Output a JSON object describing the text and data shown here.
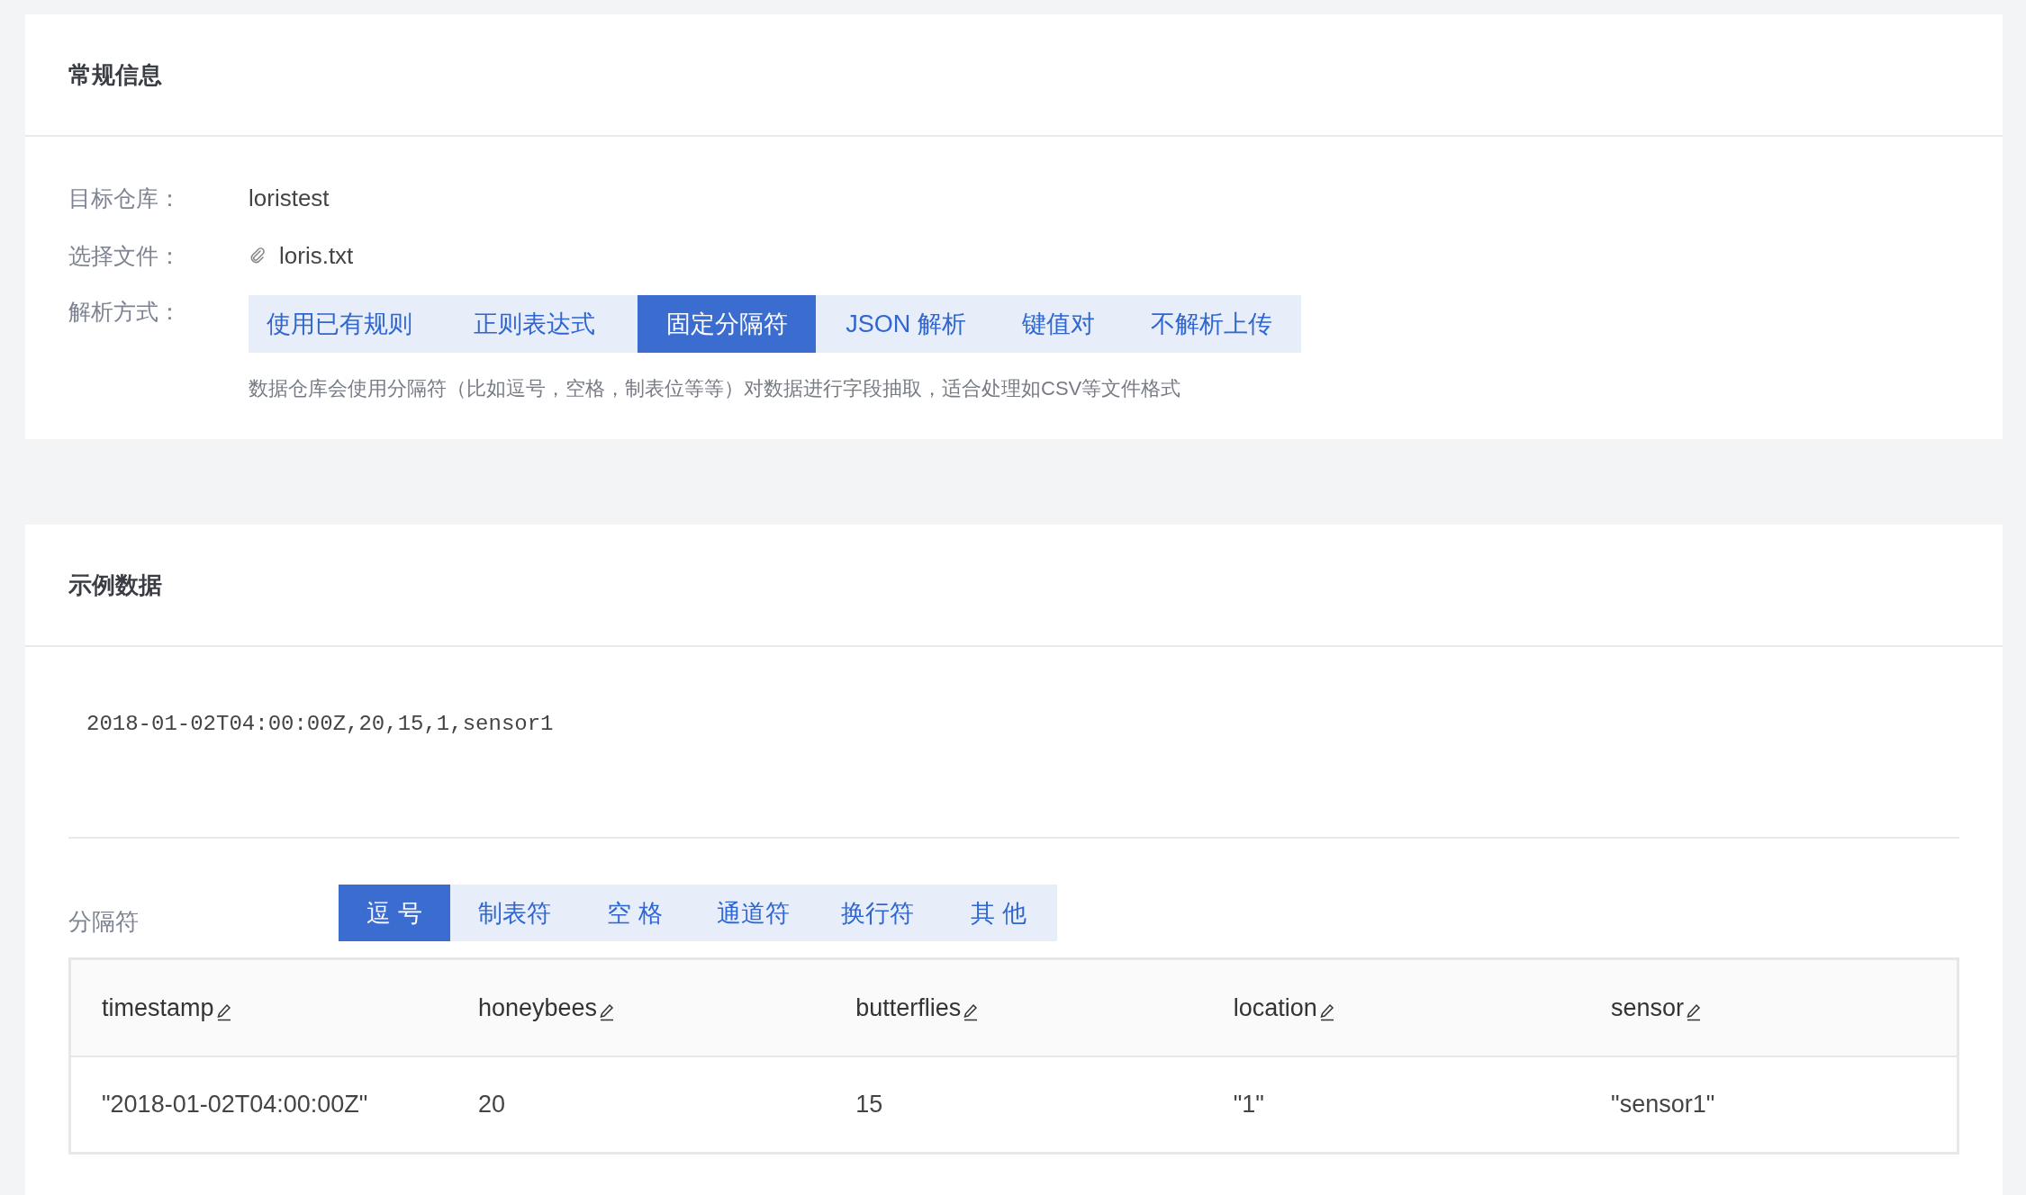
{
  "general": {
    "title": "常规信息",
    "target_label": "目标仓库：",
    "target_value": "loristest",
    "file_label": "选择文件：",
    "file_name": "loris.txt",
    "parse_label": "解析方式：",
    "parse_tabs": [
      {
        "label": "使用已有规则",
        "selected": false
      },
      {
        "label": "正则表达式",
        "selected": false
      },
      {
        "label": "固定分隔符",
        "selected": true
      },
      {
        "label": "JSON 解析",
        "selected": false
      },
      {
        "label": "键值对",
        "selected": false
      },
      {
        "label": "不解析上传",
        "selected": false
      }
    ],
    "hint": "数据仓库会使用分隔符（比如逗号，空格，制表位等等）对数据进行字段抽取，适合处理如CSV等文件格式"
  },
  "sample": {
    "title": "示例数据",
    "text": "2018-01-02T04:00:00Z,20,15,1,sensor1",
    "separator_label": "分隔符",
    "separator_tabs": [
      {
        "label": "逗 号",
        "selected": true
      },
      {
        "label": "制表符",
        "selected": false
      },
      {
        "label": "空 格",
        "selected": false
      },
      {
        "label": "通道符",
        "selected": false
      },
      {
        "label": "换行符",
        "selected": false
      },
      {
        "label": "其 他",
        "selected": false
      }
    ],
    "table": {
      "columns": [
        "timestamp",
        "honeybees",
        "butterflies",
        "location",
        "sensor"
      ],
      "rows": [
        [
          "\"2018-01-02T04:00:00Z\"",
          "20",
          "15",
          "\"1\"",
          "\"sensor1\""
        ]
      ]
    }
  }
}
